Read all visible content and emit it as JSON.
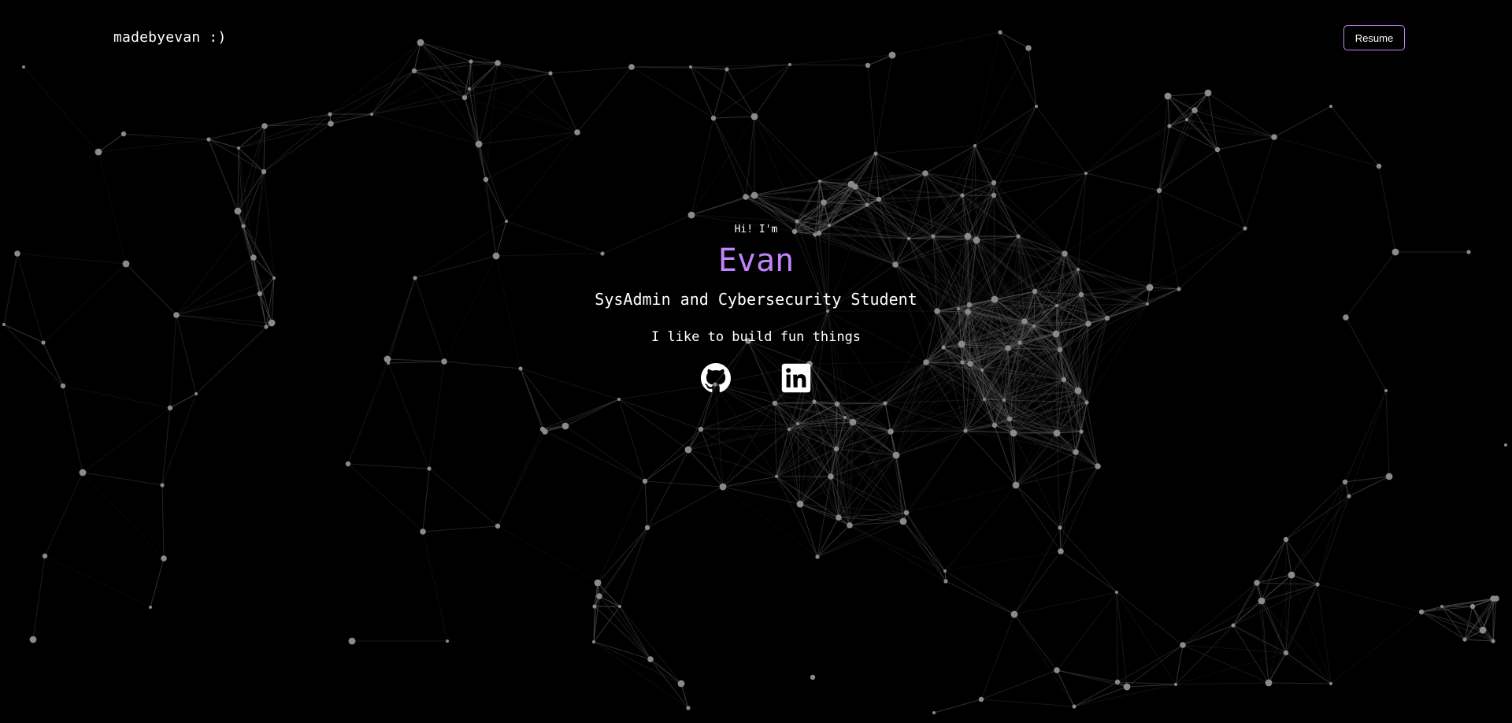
{
  "header": {
    "logo_text": "madebyevan :)",
    "resume_label": "Resume"
  },
  "hero": {
    "greeting": "Hi! I'm",
    "name": "Evan",
    "role": "SysAdmin and Cybersecurity Student",
    "tagline": "I like to build fun things"
  },
  "socials": [
    {
      "icon": "github-icon",
      "label": "GitHub"
    },
    {
      "icon": "linkedin-icon",
      "label": "LinkedIn"
    }
  ],
  "colors": {
    "background": "#000000",
    "accent": "#c084fc",
    "text": "#ffffff",
    "particle": "#8a8a8a",
    "link_line": "#5a5a5a"
  }
}
